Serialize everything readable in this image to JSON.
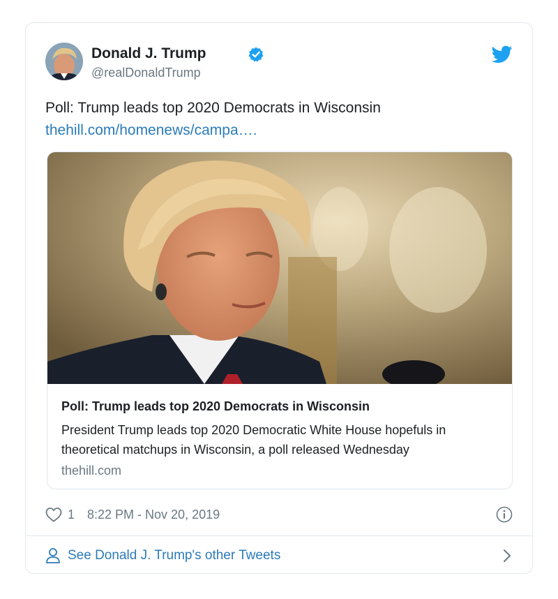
{
  "tweet": {
    "author": {
      "display_name": "Donald J. Trump",
      "handle": "@realDonaldTrump",
      "verified": true
    },
    "text": "Poll: Trump leads top 2020 Democrats in Wisconsin",
    "link_text": "thehill.com/homenews/campa….",
    "card": {
      "title": "Poll: Trump leads top 2020 Democrats in Wisconsin",
      "description": "President Trump leads top 2020 Democratic White House hopefuls in theoretical matchups in Wisconsin, a poll released Wednesday",
      "domain": "thehill.com"
    },
    "likes": "1",
    "timestamp": "8:22 PM - Nov 20, 2019",
    "see_more_label": "See Donald J. Trump's other Tweets"
  },
  "icons": {
    "verified": "verified-badge-icon",
    "brand": "twitter-bird-icon",
    "like": "heart-icon",
    "info": "info-icon",
    "profile": "person-icon",
    "more": "chevron-right-icon"
  },
  "colors": {
    "link": "#2b7bb9",
    "brand_blue": "#1da1f2",
    "secondary_text": "#697882",
    "border": "#e1e8ed"
  }
}
